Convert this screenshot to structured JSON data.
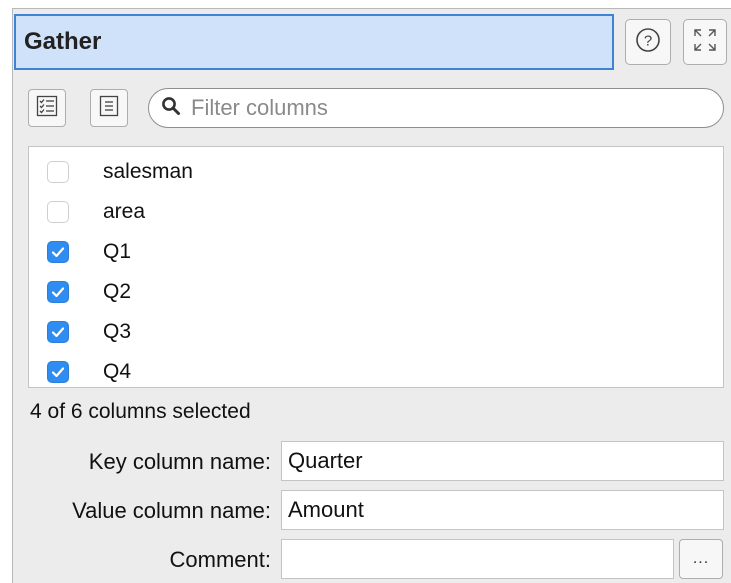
{
  "panel": {
    "title": "Gather",
    "help_icon": "question-circle-icon",
    "expand_icon": "expand-arrows-icon"
  },
  "toolbar": {
    "select_all_icon": "checklist-icon",
    "select_none_icon": "list-icon",
    "filter_placeholder": "Filter columns",
    "filter_value": ""
  },
  "columns": [
    {
      "label": "salesman",
      "checked": false
    },
    {
      "label": "area",
      "checked": false
    },
    {
      "label": "Q1",
      "checked": true
    },
    {
      "label": "Q2",
      "checked": true
    },
    {
      "label": "Q3",
      "checked": true
    },
    {
      "label": "Q4",
      "checked": true
    }
  ],
  "status": "4 of 6 columns selected",
  "form": {
    "key_label": "Key column name:",
    "key_value": "Quarter",
    "value_label": "Value column name:",
    "value_value": "Amount",
    "comment_label": "Comment:",
    "comment_value": "",
    "comment_more": "..."
  },
  "colors": {
    "title_bg": "#cfe2f9",
    "title_border": "#3d83d6",
    "checkbox_on": "#2f8cf0"
  }
}
